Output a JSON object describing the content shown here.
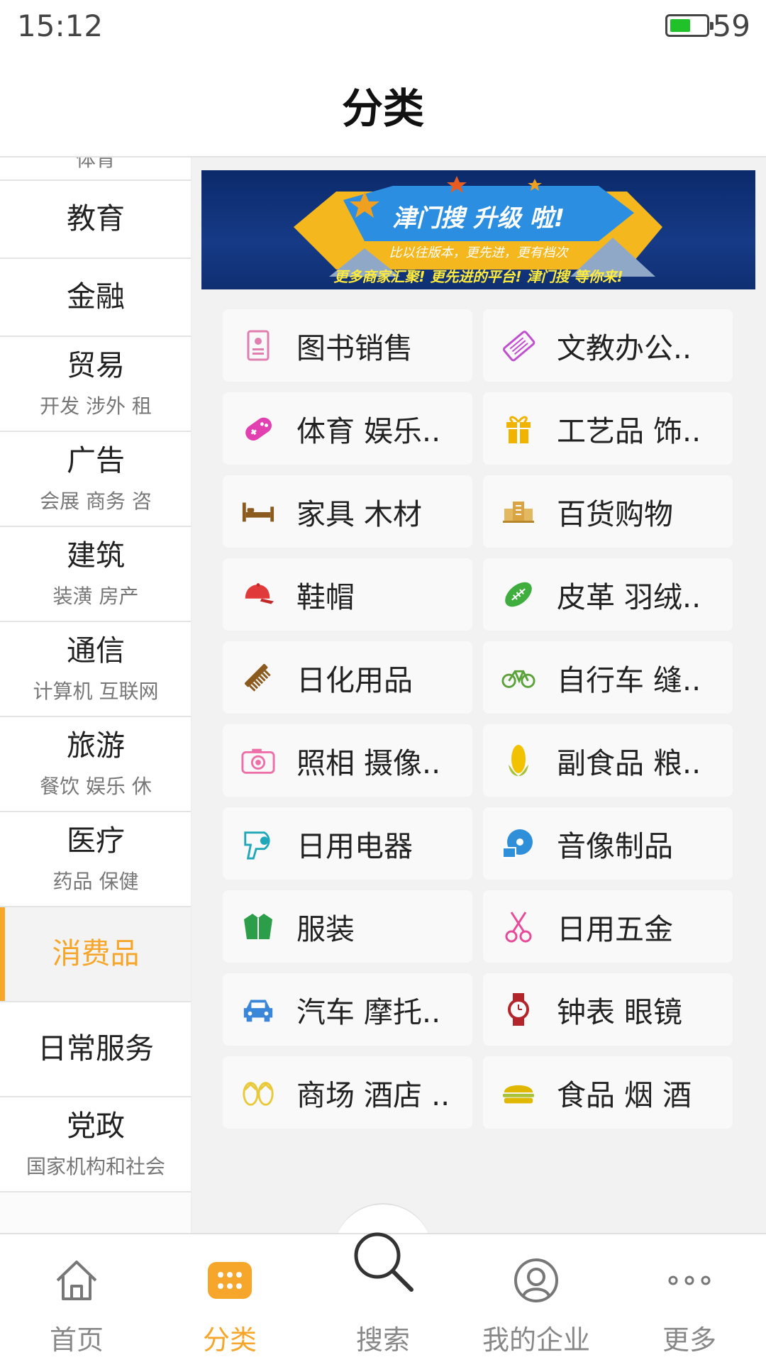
{
  "status": {
    "time": "15:12",
    "battery": "59"
  },
  "header": {
    "title": "分类"
  },
  "sidebar": {
    "items": [
      {
        "label": "体育",
        "sub": ""
      },
      {
        "label": "教育",
        "sub": ""
      },
      {
        "label": "金融",
        "sub": ""
      },
      {
        "label": "贸易",
        "sub": "开发 涉外 租"
      },
      {
        "label": "广告",
        "sub": "会展 商务 咨"
      },
      {
        "label": "建筑",
        "sub": "装潢 房产"
      },
      {
        "label": "通信",
        "sub": "计算机 互联网"
      },
      {
        "label": "旅游",
        "sub": "餐饮 娱乐 休"
      },
      {
        "label": "医疗",
        "sub": "药品 保健"
      },
      {
        "label": "消费品",
        "sub": "",
        "active": true
      },
      {
        "label": "日常服务",
        "sub": ""
      },
      {
        "label": "党政",
        "sub": "国家机构和社会"
      }
    ]
  },
  "banner": {
    "title": "津门搜 升级 啦!",
    "subtitle": "比以往版本，更先进，更有档次",
    "tagline": "更多商家汇聚! 更先进的平台! 津门搜 等你来!"
  },
  "categories": [
    {
      "label": "图书销售",
      "icon": "book-icon",
      "color": "#e07fb0"
    },
    {
      "label": "文教办公..",
      "icon": "ticket-icon",
      "color": "#c04fcf"
    },
    {
      "label": "体育 娱乐..",
      "icon": "gamepad-icon",
      "color": "#e23fb0"
    },
    {
      "label": "工艺品 饰..",
      "icon": "gift-icon",
      "color": "#f0b400"
    },
    {
      "label": "家具 木材",
      "icon": "bed-icon",
      "color": "#8a5a1e"
    },
    {
      "label": "百货购物",
      "icon": "store-icon",
      "color": "#d9a441"
    },
    {
      "label": "鞋帽",
      "icon": "cap-icon",
      "color": "#e03a3a"
    },
    {
      "label": "皮革 羽绒..",
      "icon": "football-icon",
      "color": "#3fae3f"
    },
    {
      "label": "日化用品",
      "icon": "comb-icon",
      "color": "#8a5a1e"
    },
    {
      "label": "自行车 缝..",
      "icon": "bicycle-icon",
      "color": "#5ca23a"
    },
    {
      "label": "照相 摄像..",
      "icon": "camera-icon",
      "color": "#ee6fa8"
    },
    {
      "label": "副食品 粮..",
      "icon": "corn-icon",
      "color": "#f2c200"
    },
    {
      "label": "日用电器",
      "icon": "hairdryer-icon",
      "color": "#20a8b8"
    },
    {
      "label": "音像制品",
      "icon": "disc-icon",
      "color": "#2f8fd8"
    },
    {
      "label": "服装",
      "icon": "jacket-icon",
      "color": "#2c9e4a"
    },
    {
      "label": "日用五金",
      "icon": "scissors-icon",
      "color": "#e84a9a"
    },
    {
      "label": "汽车 摩托..",
      "icon": "car-icon",
      "color": "#3a86d8"
    },
    {
      "label": "钟表 眼镜",
      "icon": "watch-icon",
      "color": "#b4252b"
    },
    {
      "label": "商场 酒店 ..",
      "icon": "flipflops-icon",
      "color": "#e8c93a"
    },
    {
      "label": "食品 烟 酒",
      "icon": "burger-icon",
      "color": "#e0b800"
    }
  ],
  "bottom_nav": {
    "items": [
      {
        "label": "首页",
        "icon": "home-icon"
      },
      {
        "label": "分类",
        "icon": "category-icon",
        "active": true
      },
      {
        "label": "搜索",
        "icon": "search-icon"
      },
      {
        "label": "我的企业",
        "icon": "profile-icon"
      },
      {
        "label": "更多",
        "icon": "more-icon"
      }
    ]
  },
  "colors": {
    "accent": "#f6a72b",
    "battery": "#21c12a"
  }
}
